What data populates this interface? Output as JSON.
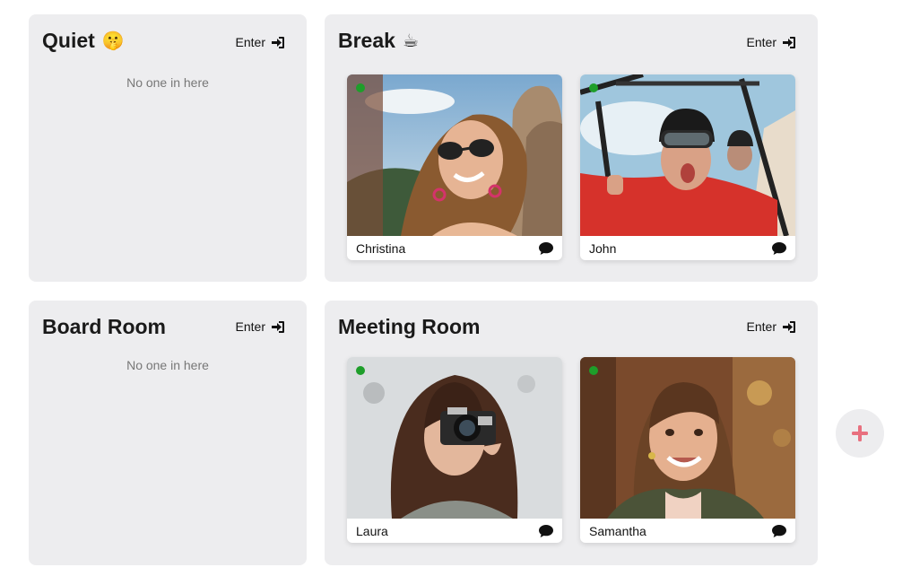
{
  "rooms": {
    "quiet": {
      "title": "Quiet",
      "emoji": "🤫",
      "enter_label": "Enter",
      "empty_text": "No one in here"
    },
    "break": {
      "title": "Break",
      "emoji": "☕",
      "enter_label": "Enter"
    },
    "board_room": {
      "title": "Board Room",
      "enter_label": "Enter",
      "empty_text": "No one in here"
    },
    "meeting_room": {
      "title": "Meeting Room",
      "enter_label": "Enter"
    }
  },
  "participants": [
    {
      "name": "Christina",
      "room": "Break",
      "online": true
    },
    {
      "name": "John",
      "room": "Break",
      "online": true
    },
    {
      "name": "Laura",
      "room": "Meeting Room",
      "online": true
    },
    {
      "name": "Samantha",
      "room": "Meeting Room",
      "online": true
    }
  ],
  "icons": {
    "enter": "sign-in-icon",
    "chat": "comment-icon",
    "add": "plus-icon"
  },
  "colors": {
    "room_bg": "#ededef",
    "online": "#1e9e2a",
    "add_accent": "#e8707f"
  }
}
